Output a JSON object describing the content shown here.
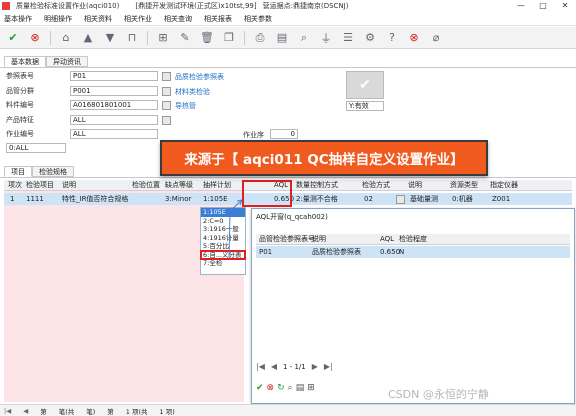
{
  "window": {
    "title": "质量检验标准设置作业(aqci010)",
    "subtitle": "[鼎捷开发测试环境(正式区)x10tst,99]",
    "user": "营运据点:鼎捷南京(DSCNJ)",
    "controls": [
      "—",
      "□",
      "✕"
    ]
  },
  "menu": [
    "基本操作",
    "明细操作",
    "相关资料",
    "相关作业",
    "相关查询",
    "相关报表",
    "相关参数"
  ],
  "toolbar_icons": [
    "check-icon",
    "cancel-icon",
    "home-icon",
    "up-icon",
    "down-icon",
    "lock-icon",
    "new-icon",
    "edit-icon",
    "delete-icon",
    "copy-icon",
    "print-icon",
    "export-icon",
    "search-icon",
    "filter-icon",
    "list-icon",
    "settings-icon",
    "help-icon",
    "close-icon",
    "attach-icon"
  ],
  "top_tabs": [
    "基本数据",
    "异动资讯"
  ],
  "form": {
    "fields": [
      {
        "label": "参照表号",
        "value": "P01",
        "link": "品质检验参照表"
      },
      {
        "label": "品管分群",
        "value": "P001",
        "link": "材料类检验"
      },
      {
        "label": "料件编号",
        "value": "A016801801001",
        "link": "导热管"
      },
      {
        "label": "产品特征",
        "value": "ALL",
        "link": ""
      },
      {
        "label": "作业编号",
        "value": "ALL",
        "link": ""
      }
    ],
    "status_label": "Y:有效",
    "extra_label": "作业序",
    "extra_value": "0",
    "bottom_select": "0:ALL"
  },
  "banner": {
    "text": "来源于【 aqci011 QC抽样自定义设置作业】"
  },
  "grid": {
    "tabs": [
      "项目",
      "检验规格"
    ],
    "headers": [
      "项次",
      "检验项目",
      "说明",
      "检验位置",
      "缺点等级",
      "抽样计划",
      "AQL",
      "数量控制方式",
      "检验方式",
      "说明",
      "资源类型",
      "指定仪器"
    ],
    "row": [
      "1",
      "1111",
      "特性_IR值否符合规格",
      "",
      "3:Minor",
      "1:105E",
      "0.650",
      "2:量测不合格",
      "02",
      "基础量测",
      "0:机器",
      "Z001"
    ]
  },
  "dropdown": {
    "items": [
      "1:105E",
      "2:C=0",
      "3:1916一般",
      "4:1916计量",
      "5:百分比",
      "6:自...义分表",
      "7:全检"
    ]
  },
  "popup": {
    "title": "AQL开窗(q_qcah002)",
    "headers": [
      "品管检验参照表号",
      "说明",
      "AQL",
      "检验程度"
    ],
    "row": [
      "P01",
      "品质检验参照表",
      "0.650",
      "N"
    ],
    "pager": "1 - 1/1"
  },
  "statusbar": {
    "left": "第",
    "items": [
      "笔(共",
      "笔)",
      "第",
      "1 项(共",
      "1 项)"
    ]
  },
  "watermark": "CSDN @永恒的宁静",
  "colors": {
    "accent_red": "#e02020",
    "banner_bg": "#f05a1e",
    "link": "#1a6fc4",
    "selected_row": "#cfe3f7",
    "left_panel": "#fde4e6"
  }
}
